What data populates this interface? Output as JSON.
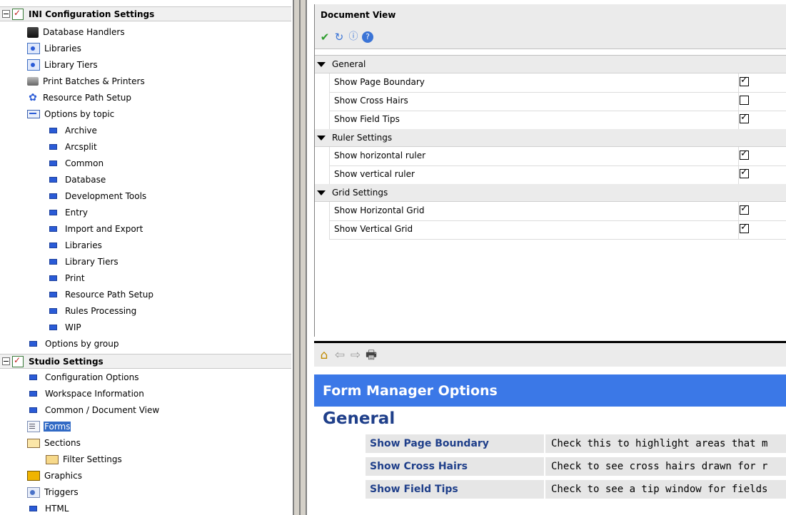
{
  "tree": {
    "ini_header": "INI Configuration Settings",
    "ini_items": [
      {
        "label": "Database Handlers",
        "icon": "database-icon"
      },
      {
        "label": "Libraries",
        "icon": "library-icon"
      },
      {
        "label": "Library Tiers",
        "icon": "library-icon"
      },
      {
        "label": "Print Batches & Printers",
        "icon": "printer-icon"
      },
      {
        "label": "Resource Path Setup",
        "icon": "resource-path-icon"
      }
    ],
    "options_by_topic": "Options by topic",
    "topic_items": [
      "Archive",
      "Arcsplit",
      "Common",
      "Database",
      "Development Tools",
      "Entry",
      "Import and Export",
      "Libraries",
      "Library Tiers",
      "Print",
      "Resource Path Setup",
      "Rules Processing",
      "WIP"
    ],
    "options_by_group": "Options by group",
    "studio_header": "Studio Settings",
    "studio_items": [
      {
        "label": "Configuration Options"
      },
      {
        "label": "Workspace Information"
      },
      {
        "label": "Common / Document View"
      },
      {
        "label": "Forms"
      },
      {
        "label": "Sections"
      },
      {
        "label": "Filter Settings"
      },
      {
        "label": "Graphics"
      },
      {
        "label": "Triggers"
      },
      {
        "label": "HTML"
      }
    ]
  },
  "docview": {
    "title": "Document View",
    "toolbar": [
      "apply-check-icon",
      "refresh-icon",
      "info-icon",
      "help-icon"
    ],
    "sections": [
      {
        "label": "General",
        "rows": [
          {
            "label": "Show Page Boundary",
            "checked": true
          },
          {
            "label": "Show Cross Hairs",
            "checked": false
          },
          {
            "label": "Show Field Tips",
            "checked": true
          }
        ]
      },
      {
        "label": "Ruler Settings",
        "rows": [
          {
            "label": "Show horizontal ruler",
            "checked": true
          },
          {
            "label": "Show vertical ruler",
            "checked": true
          }
        ]
      },
      {
        "label": "Grid Settings",
        "rows": [
          {
            "label": "Show Horizontal Grid",
            "checked": true
          },
          {
            "label": "Show Vertical Grid",
            "checked": true
          }
        ]
      }
    ]
  },
  "help": {
    "toolbar": [
      "home-icon",
      "back-arrow-icon",
      "forward-arrow-icon",
      "print-icon"
    ],
    "banner": "Form Manager Options",
    "heading": "General",
    "rows": [
      {
        "key": "Show Page Boundary",
        "desc": "Check this to highlight areas that m"
      },
      {
        "key": "Show Cross Hairs",
        "desc": "Check to see cross hairs drawn for r"
      },
      {
        "key": "Show Field Tips",
        "desc": "Check to see a tip window for fields"
      }
    ]
  },
  "colors": {
    "banner": "#3b78e7",
    "link": "#1f3f8a",
    "selection": "#316ac5",
    "tree_bullet": "#2a5bd7"
  }
}
